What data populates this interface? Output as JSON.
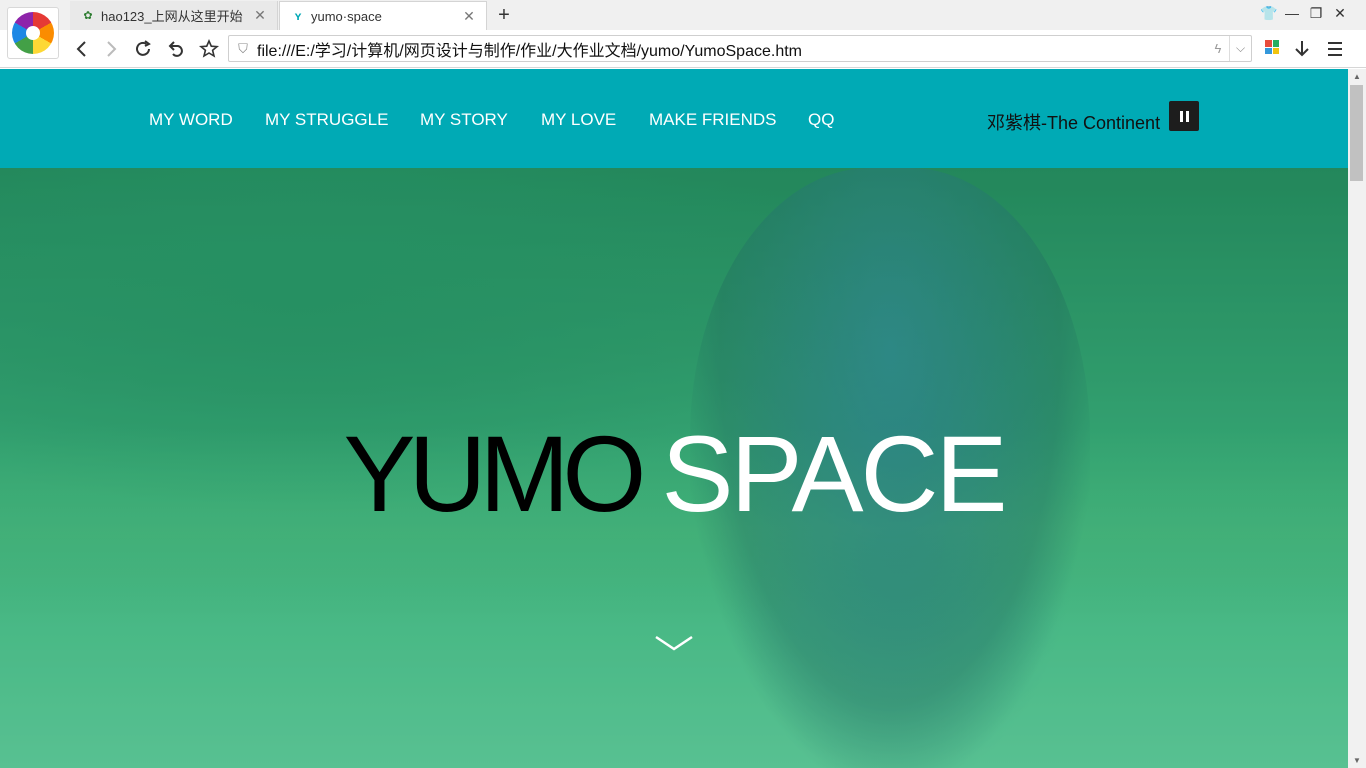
{
  "browser": {
    "tabs": [
      {
        "title": "hao123_上网从这里开始",
        "favicon": "hao123-icon",
        "active": false
      },
      {
        "title": "yumo·space",
        "favicon": "yumo-icon",
        "active": true
      }
    ],
    "address": "file:///E:/学习/计算机/网页设计与制作/作业/大作业文档/yumo/YumoSpace.htm"
  },
  "header": {
    "nav": [
      "MY WORD",
      "MY STRUGGLE",
      "MY STORY",
      "MY LOVE",
      "MAKE FRIENDS",
      "QQ"
    ],
    "music": {
      "artist": "邓紫棋",
      "song": "-The Continent"
    },
    "color": "#00aab5"
  },
  "hero": {
    "title_word1": "YUMO",
    "title_word2": "SPACE"
  }
}
